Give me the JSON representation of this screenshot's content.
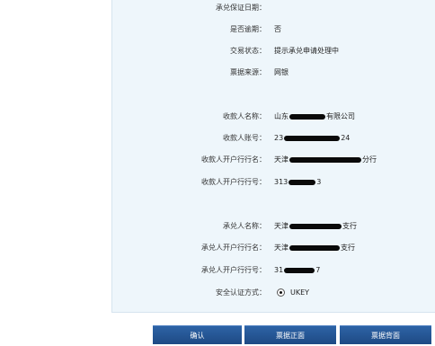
{
  "form": {
    "rows": [
      {
        "label": "承兑保证日期：",
        "value": ""
      },
      {
        "label": "是否逾期：",
        "value": "否"
      },
      {
        "label": "交易状态：",
        "value": "提示承兑申请处理中"
      },
      {
        "label": "票据来源：",
        "value": "网银"
      },
      {
        "label": "收款人名称：",
        "value_prefix": "山东",
        "value_suffix": "有限公司"
      },
      {
        "label": "收款人账号：",
        "value_prefix": "23",
        "value_suffix": "24"
      },
      {
        "label": "收款人开户行行名：",
        "value_prefix": "天津",
        "value_suffix": "分行"
      },
      {
        "label": "收款人开户行行号：",
        "value_prefix": "313",
        "value_suffix": "3"
      },
      {
        "label": "承兑人名称：",
        "value_prefix": "天津",
        "value_suffix": "支行"
      },
      {
        "label": "承兑人开户行行名：",
        "value_prefix": "天津",
        "value_suffix": "支行"
      },
      {
        "label": "承兑人开户行行号：",
        "value_prefix": "31",
        "value_suffix": "7"
      },
      {
        "label": "安全认证方式：",
        "value": "UKEY"
      }
    ]
  },
  "buttons": {
    "confirm": "确认",
    "front": "票据正面",
    "back": "票据背面"
  },
  "icons": {
    "auth_radio": "radio-selected-icon"
  }
}
